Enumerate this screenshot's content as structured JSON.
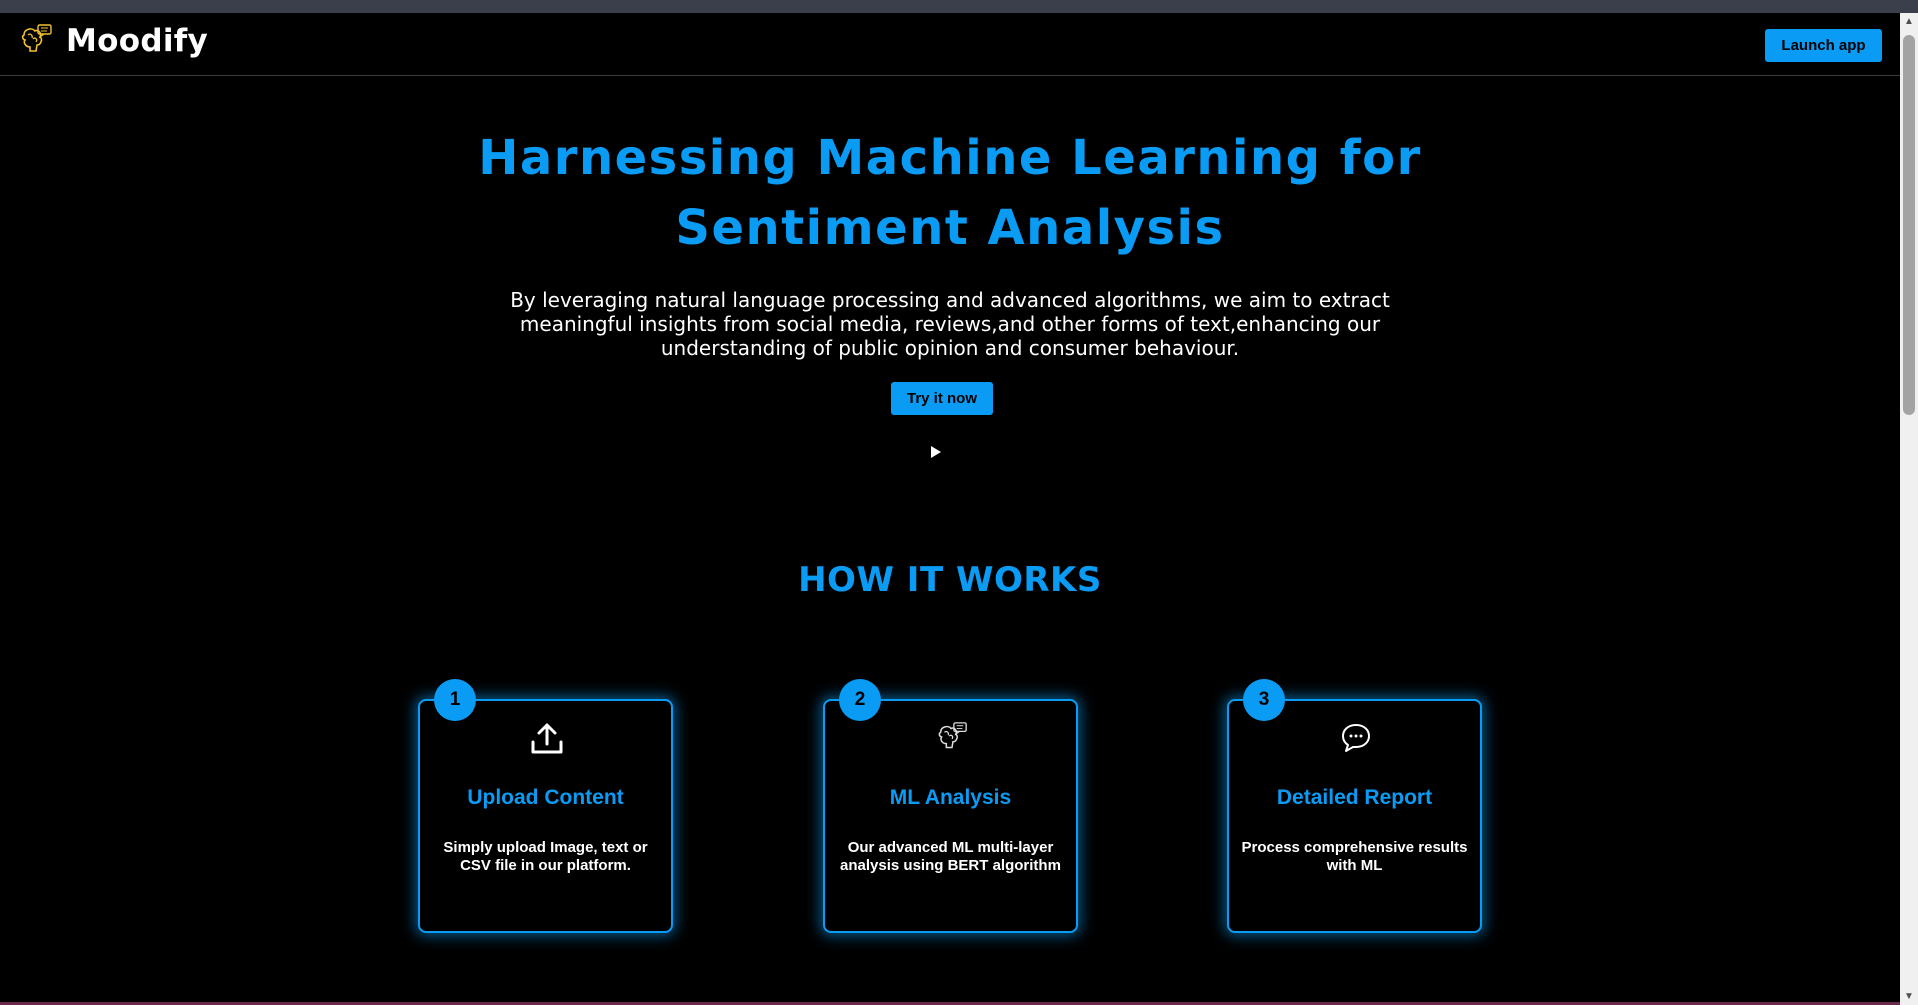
{
  "header": {
    "brand_name": "Moodify",
    "launch_button": "Launch app"
  },
  "hero": {
    "title_line1": "Harnessing Machine Learning for",
    "title_line2": "Sentiment Analysis",
    "description": "By leveraging natural language processing and advanced algorithms, we aim to extract meaningful insights from social media, reviews,and other forms of text,enhancing our understanding of public opinion and consumer behaviour.",
    "cta_button": "Try it now"
  },
  "how_it_works": {
    "title": "HOW IT WORKS",
    "steps": [
      {
        "number": "1",
        "icon": "upload-icon",
        "title": "Upload Content",
        "description": "Simply upload Image, text or CSV file in our platform."
      },
      {
        "number": "2",
        "icon": "brain-chat-icon",
        "title": "ML Analysis",
        "description": "Our advanced ML multi-layer analysis using BERT algorithm"
      },
      {
        "number": "3",
        "icon": "chat-bubble-icon",
        "title": "Detailed Report",
        "description": "Process comprehensive results with ML"
      }
    ]
  },
  "colors": {
    "accent": "#0a9cf5",
    "background": "#000000",
    "text": "#ffffff"
  }
}
